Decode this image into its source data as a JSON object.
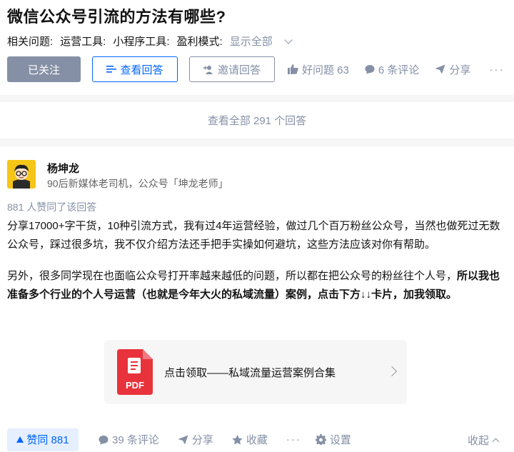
{
  "question": {
    "title": "微信公众号引流的方法有哪些?",
    "topics_label": "相关问题:",
    "topics": [
      "运营工具:",
      "小程序工具:",
      "盈利模式:"
    ],
    "show_all": "显示全部"
  },
  "actions": {
    "follow": "已关注",
    "view_answers": "查看回答",
    "invite": "邀请回答",
    "good_question": "好问题 63",
    "comments": "6 条评论",
    "share": "分享",
    "more": "···"
  },
  "view_all": "查看全部 291 个回答",
  "answer": {
    "author_name": "杨坤龙",
    "author_bio": "90后新媒体老司机，公众号「坤龙老师」",
    "upvote_info": "881 人赞同了该回答",
    "paragraph1": "分享17000+字干货，10种引流方式，我有过4年运营经验，做过几个百万粉丝公众号，当然也做死过无数公众号，踩过很多坑，我不仅介绍方法还手把手实操如何避坑，这些方法应该对你有帮助。",
    "paragraph2_normal": "另外，很多同学现在也面临公众号打开率越来越低的问题，所以都在把公众号的粉丝往个人号，",
    "paragraph2_bold": "所以我也准备多个行业的个人号运营（也就是今年大火的私域流量）案例，点击下方↓↓卡片，加我领取。",
    "card_text": "点击领取——私域流量运营案例合集",
    "pdf_label": "PDF"
  },
  "bottom": {
    "vote": "赞同 881",
    "comments": "39 条评论",
    "share": "分享",
    "favorite": "收藏",
    "more": "···",
    "settings": "设置",
    "collapse": "收起"
  },
  "colors": {
    "accent": "#0066ff",
    "muted": "#8590a6",
    "pdf_red": "#e8333c"
  }
}
